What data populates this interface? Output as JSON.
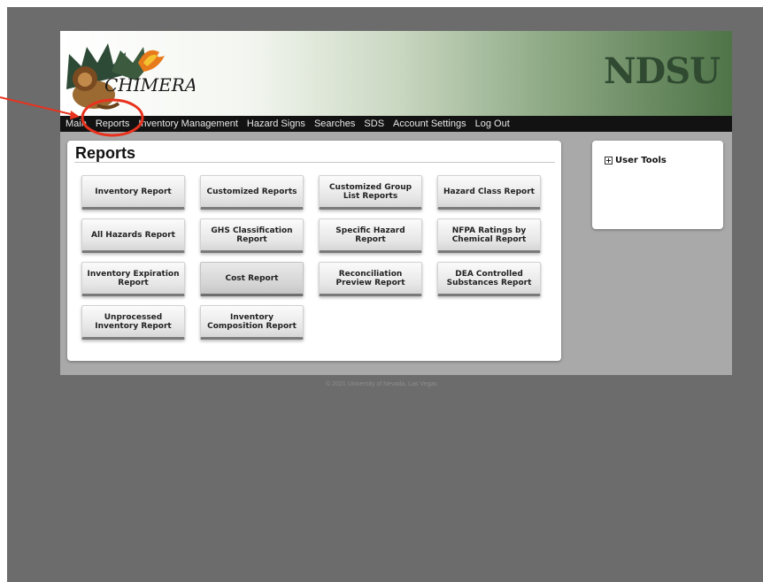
{
  "banner": {
    "logo_text": "CHIMERA",
    "institution": "NDSU"
  },
  "nav": {
    "items": [
      "Main",
      "Reports",
      "Inventory Management",
      "Hazard Signs",
      "Searches",
      "SDS",
      "Account Settings",
      "Log Out"
    ]
  },
  "reports": {
    "title": "Reports",
    "buttons": [
      "Inventory Report",
      "Customized Reports",
      "Customized Group List Reports",
      "Hazard Class Report",
      "All Hazards Report",
      "GHS Classification Report",
      "Specific Hazard Report",
      "NFPA Ratings by Chemical Report",
      "Inventory Expiration Report",
      "Cost Report",
      "Reconciliation Preview Report",
      "DEA Controlled Substances Report",
      "Unprocessed Inventory Report",
      "Inventory Composition Report"
    ]
  },
  "user_tools": {
    "label": "User Tools",
    "icon": "plus-box-icon"
  },
  "footer": {
    "text": "© 2021 University of Nevada, Las Vegas"
  },
  "annotation": {
    "color": "#e8321e",
    "highlighted": "Reports"
  }
}
